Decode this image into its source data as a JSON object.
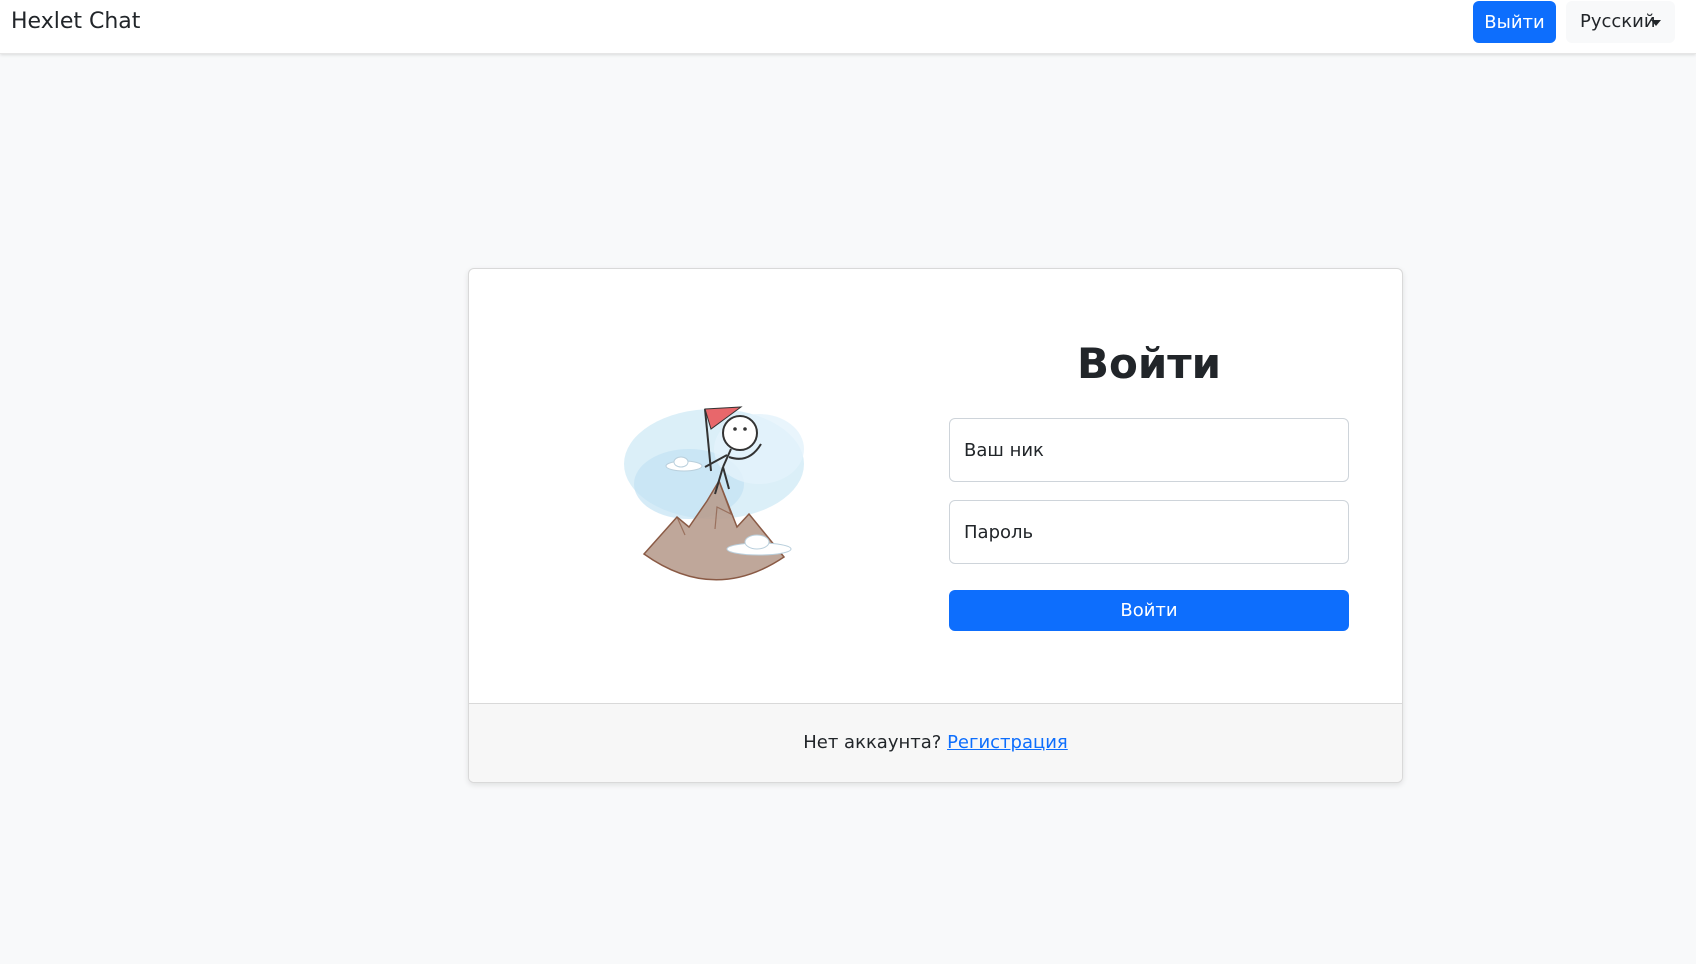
{
  "navbar": {
    "brand": "Hexlet Chat",
    "logout_label": "Выйти",
    "language_label": "Русский"
  },
  "login": {
    "title": "Войти",
    "username_placeholder": "Ваш ник",
    "password_placeholder": "Пароль",
    "submit_label": "Войти"
  },
  "footer": {
    "no_account_text": "Нет аккаунта?",
    "signup_link": "Регистрация"
  },
  "colors": {
    "primary": "#0d6efd",
    "background": "#f8f9fa",
    "flag": "#e8676b"
  },
  "icons": {
    "dropdown": "caret-down-icon",
    "illustration": "mountain-climber-illustration"
  }
}
